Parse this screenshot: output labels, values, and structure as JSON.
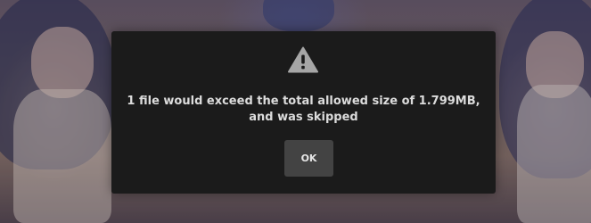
{
  "dialog": {
    "icon": "warning-triangle-icon",
    "message": "1 file would exceed the total allowed size of 1.799MB, and was skipped",
    "ok_label": "OK"
  },
  "colors": {
    "dialog_background": "#1b1b1b",
    "button_background": "#434343",
    "text": "#dcdcdc",
    "icon": "#a6a6a6"
  }
}
